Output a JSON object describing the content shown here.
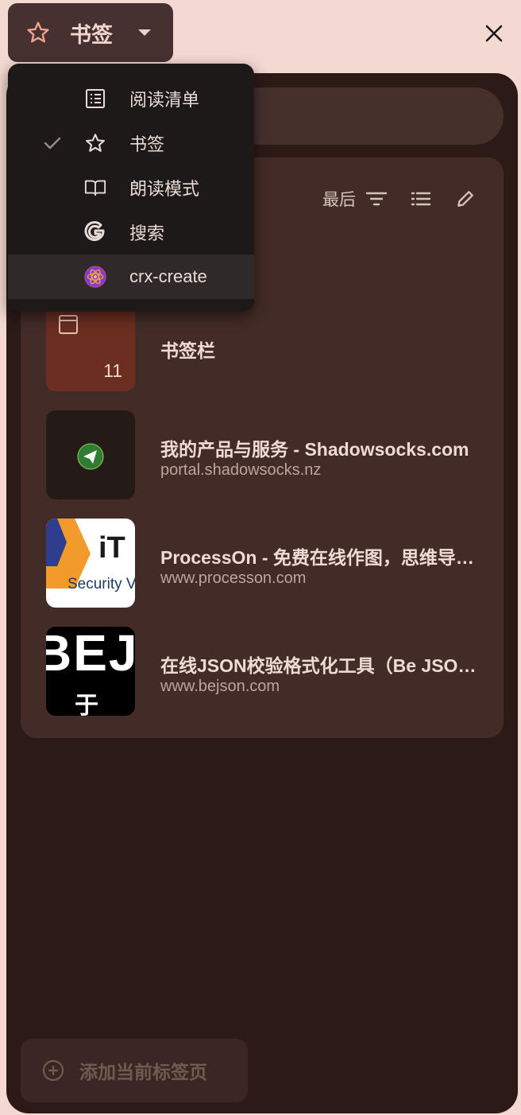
{
  "header": {
    "title": "书签"
  },
  "toolbar": {
    "sort_label": "最后"
  },
  "menu": {
    "items": [
      {
        "label": "阅读清单",
        "icon": "list-icon",
        "checked": false
      },
      {
        "label": "书签",
        "icon": "star-icon",
        "checked": true
      },
      {
        "label": "朗读模式",
        "icon": "book-icon",
        "checked": false
      },
      {
        "label": "搜索",
        "icon": "google-icon",
        "checked": false
      },
      {
        "label": "crx-create",
        "icon": "extension-icon",
        "checked": false
      }
    ]
  },
  "folder": {
    "title": "书签栏",
    "count": "11"
  },
  "bookmarks": [
    {
      "title": "我的产品与服务 - Shadowsocks.com",
      "url": "portal.shadowsocks.nz"
    },
    {
      "title": "ProcessOn - 免费在线作图，思维导图，流程图，实时协作",
      "url": "www.processon.com"
    },
    {
      "title": "在线JSON校验格式化工具（Be JSON）",
      "url": "www.bejson.com"
    }
  ],
  "thumb_text": {
    "processon_top": "iT",
    "processon_bottom": "Security V",
    "bejson_top": "BEJ",
    "bejson_bottom": "于"
  },
  "footer": {
    "add_label": "添加当前标签页"
  },
  "colors": {
    "background": "#f3d9d1",
    "panel": "#2c1a16",
    "card": "#432b27",
    "menu": "#1d1918",
    "accent_star": "#f0a28e"
  }
}
